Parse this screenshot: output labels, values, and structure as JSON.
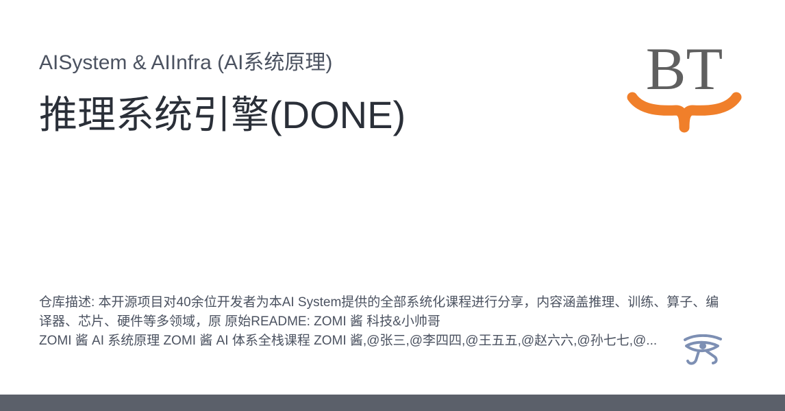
{
  "card": {
    "subtitle": "AISystem & AIInfra (AI系统原理)",
    "title": "推理系统引擎(DONE)",
    "logo_text": "BT",
    "description_line1": "仓库描述: 本开源项目对40余位开发者为本AI System提供的全部系统化课程进行分享，内容涵盖推理、训练、算子、编译器、芯片、硬件等多领域，原 原始README: ZOMI 酱 科技&小帅哥",
    "description_line2": "ZOMI 酱 AI 系统原理 ZOMI 酱 AI 体系全栈课程 ZOMI 酱,@张三,@李四四,@王五五,@赵六六,@孙七七,@..."
  },
  "icons": {
    "eye": "eye-of-horus-icon"
  },
  "colors": {
    "logo_gray": "#5f5f5f",
    "logo_orange": "#f07f2a",
    "eye_blue": "#7d8fb3",
    "footer": "#5b606a"
  }
}
